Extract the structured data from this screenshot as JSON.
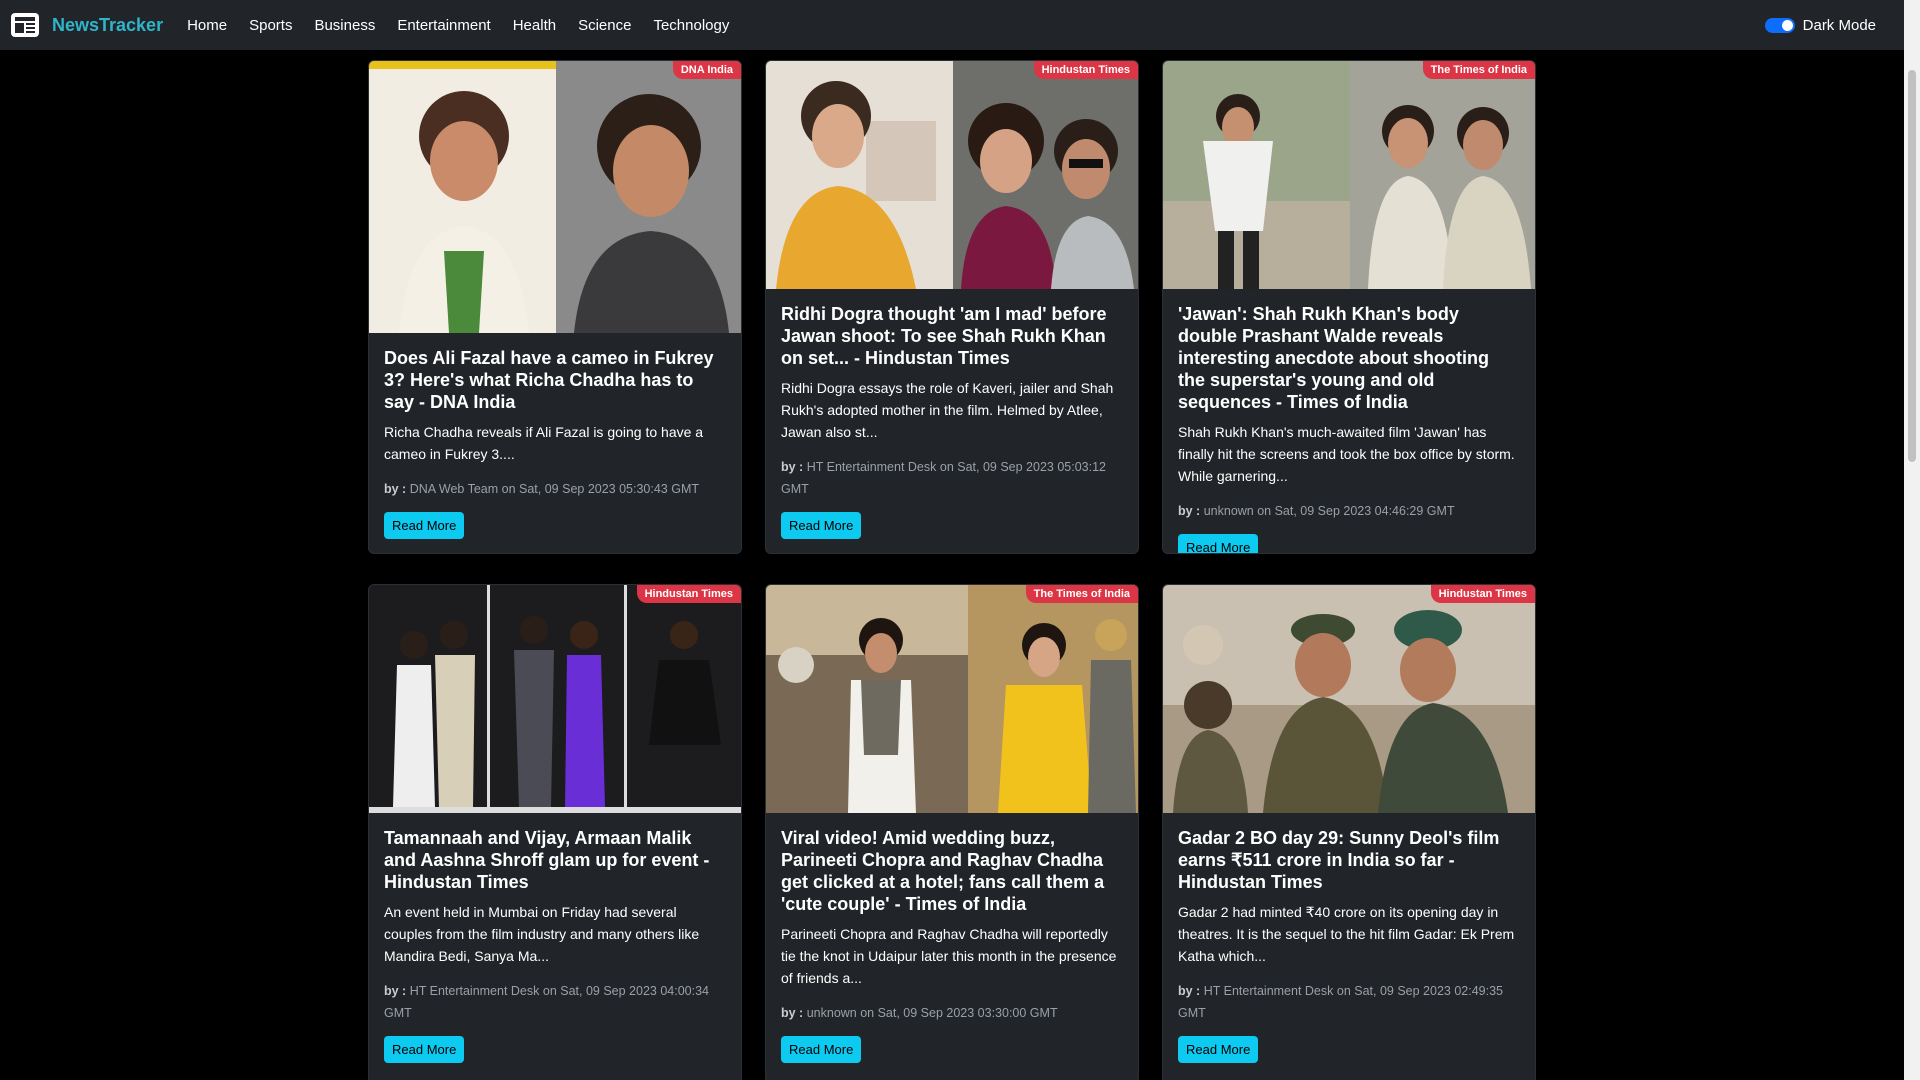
{
  "nav": {
    "brand": "NewsTracker",
    "links": [
      "Home",
      "Sports",
      "Business",
      "Entertainment",
      "Health",
      "Science",
      "Technology"
    ],
    "darkmode_label": "Dark Mode"
  },
  "cards": [
    {
      "source": "DNA India",
      "title": "Does Ali Fazal have a cameo in Fukrey 3? Here's what Richa Chadha has to say - DNA India",
      "description": "Richa Chadha reveals if Ali Fazal is going to have a cameo in Fukrey 3....",
      "by_label": "by :",
      "meta": " DNA Web Team on Sat, 09 Sep 2023 05:30:43 GMT",
      "button": "Read More"
    },
    {
      "source": "Hindustan Times",
      "title": "Ridhi Dogra thought 'am I mad' before Jawan shoot: To see Shah Rukh Khan on set... - Hindustan Times",
      "description": "Ridhi Dogra essays the role of Kaveri, jailer and Shah Rukh's adopted mother in the film. Helmed by Atlee, Jawan also st...",
      "by_label": "by :",
      "meta": " HT Entertainment Desk on Sat, 09 Sep 2023 05:03:12 GMT",
      "button": "Read More"
    },
    {
      "source": "The Times of India",
      "title": "'Jawan': Shah Rukh Khan's body double Prashant Walde reveals interesting anecdote about shooting the superstar's young and old sequences - Times of India",
      "description": "Shah Rukh Khan's much-awaited film 'Jawan' has finally hit the screens and took the box office by storm. While garnering...",
      "by_label": "by :",
      "meta": " unknown on Sat, 09 Sep 2023 04:46:29 GMT",
      "button": "Read More"
    },
    {
      "source": "Hindustan Times",
      "title": "Tamannaah and Vijay, Armaan Malik and Aashna Shroff glam up for event - Hindustan Times",
      "description": "An event held in Mumbai on Friday had several couples from the film industry and many others like Mandira Bedi, Sanya Ma...",
      "by_label": "by :",
      "meta": " HT Entertainment Desk on Sat, 09 Sep 2023 04:00:34 GMT",
      "button": "Read More"
    },
    {
      "source": "The Times of India",
      "title": "Viral video! Amid wedding buzz, Parineeti Chopra and Raghav Chadha get clicked at a hotel; fans call them a 'cute couple' - Times of India",
      "description": "Parineeti Chopra and Raghav Chadha will reportedly tie the knot in Udaipur later this month in the presence of friends a...",
      "by_label": "by :",
      "meta": " unknown on Sat, 09 Sep 2023 03:30:00 GMT",
      "button": "Read More"
    },
    {
      "source": "Hindustan Times",
      "title": "Gadar 2 BO day 29: Sunny Deol's film earns ₹511 crore in India so far - Hindustan Times",
      "description": "Gadar 2 had minted ₹40 crore on its opening day in theatres. It is the sequel to the hit film Gadar: Ek Prem Katha which...",
      "by_label": "by :",
      "meta": " HT Entertainment Desk on Sat, 09 Sep 2023 02:49:35 GMT",
      "button": "Read More"
    }
  ]
}
